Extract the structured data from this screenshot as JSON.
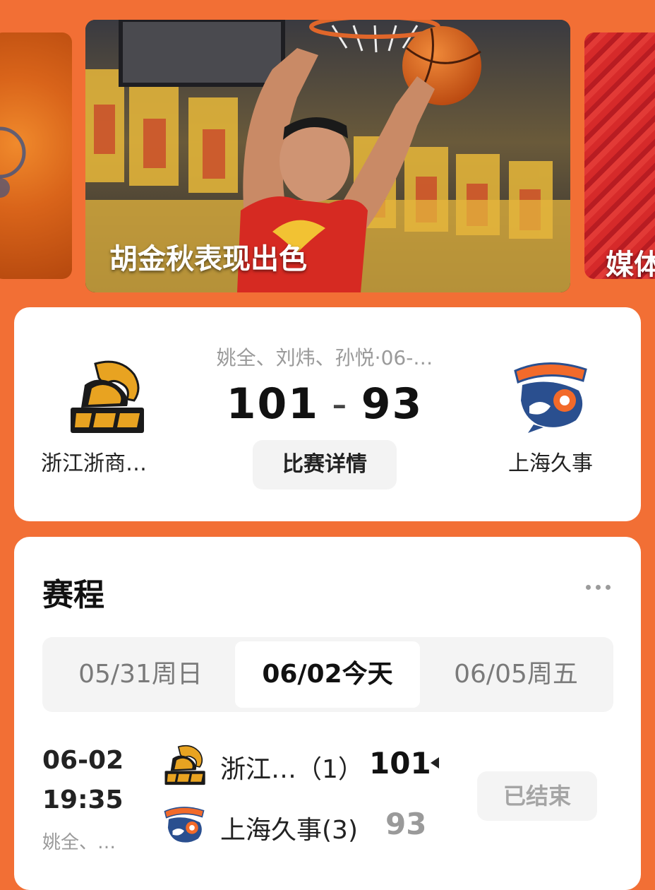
{
  "carousel": {
    "main_caption": "胡金秋表现出色",
    "right_caption": "媒体"
  },
  "match": {
    "referees": "姚全、刘炜、孙悦·06-…",
    "home_team": "浙江浙商…",
    "away_team": "上海久事",
    "home_score": "101",
    "separator": "-",
    "away_score": "93",
    "detail_button": "比赛详情"
  },
  "schedule": {
    "title": "赛程",
    "tabs": [
      {
        "label": "05/31周日",
        "active": false
      },
      {
        "label": "06/02今天",
        "active": true
      },
      {
        "label": "06/05周五",
        "active": false
      }
    ],
    "games": [
      {
        "date": "06-02",
        "time": "19:35",
        "referees": "姚全、…",
        "home": {
          "name": "浙江…（1）",
          "score": "101"
        },
        "away": {
          "name": "上海久事(3)",
          "score": "93"
        },
        "status": "已结束"
      }
    ]
  },
  "colors": {
    "background": "#f26f35",
    "lions_gold": "#e8a321",
    "sharks_blue": "#2a4f8f",
    "sharks_orange": "#f26a2a"
  }
}
